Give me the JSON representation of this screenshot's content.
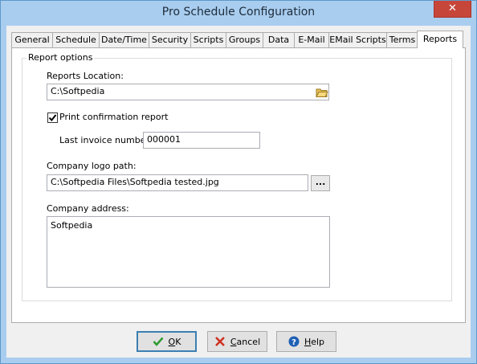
{
  "window": {
    "title": "Pro Schedule Configuration",
    "close_glyph": "✕"
  },
  "tabs": [
    {
      "label": "General"
    },
    {
      "label": "Schedule"
    },
    {
      "label": "Date/Time"
    },
    {
      "label": "Security"
    },
    {
      "label": "Scripts"
    },
    {
      "label": "Groups"
    },
    {
      "label": "Data"
    },
    {
      "label": "E-Mail"
    },
    {
      "label": "EMail Scripts"
    },
    {
      "label": "Terms"
    },
    {
      "label": "Reports"
    }
  ],
  "active_tab": "Reports",
  "report_options": {
    "group_title": "Report options",
    "reports_location_label": "Reports Location:",
    "reports_location_value": "C:\\Softpedia",
    "print_confirmation_label": "Print confirmation report",
    "print_confirmation_checked": true,
    "last_invoice_label": "Last invoice number:",
    "last_invoice_value": "000001",
    "logo_path_label": "Company logo path:",
    "logo_path_value": "C:\\Softpedia Files\\Softpedia tested.jpg",
    "browse_label": "...",
    "company_address_label": "Company address:",
    "company_address_value": "Softpedia"
  },
  "buttons": {
    "ok_accel": "O",
    "ok_rest": "K",
    "cancel_accel": "C",
    "cancel_rest": "ancel",
    "help_accel": "H",
    "help_rest": "elp"
  },
  "colors": {
    "titlebar": "#a9cdef",
    "close_button": "#c7463a",
    "ok_check": "#2e9a2e",
    "cancel_x": "#d03020",
    "help_icon": "#1f5fb5"
  },
  "icons": {
    "folder": "folder-open-icon",
    "checkmark": "checkmark-icon",
    "ok": "green-check-icon",
    "cancel": "red-x-icon",
    "help": "help-circle-icon"
  }
}
